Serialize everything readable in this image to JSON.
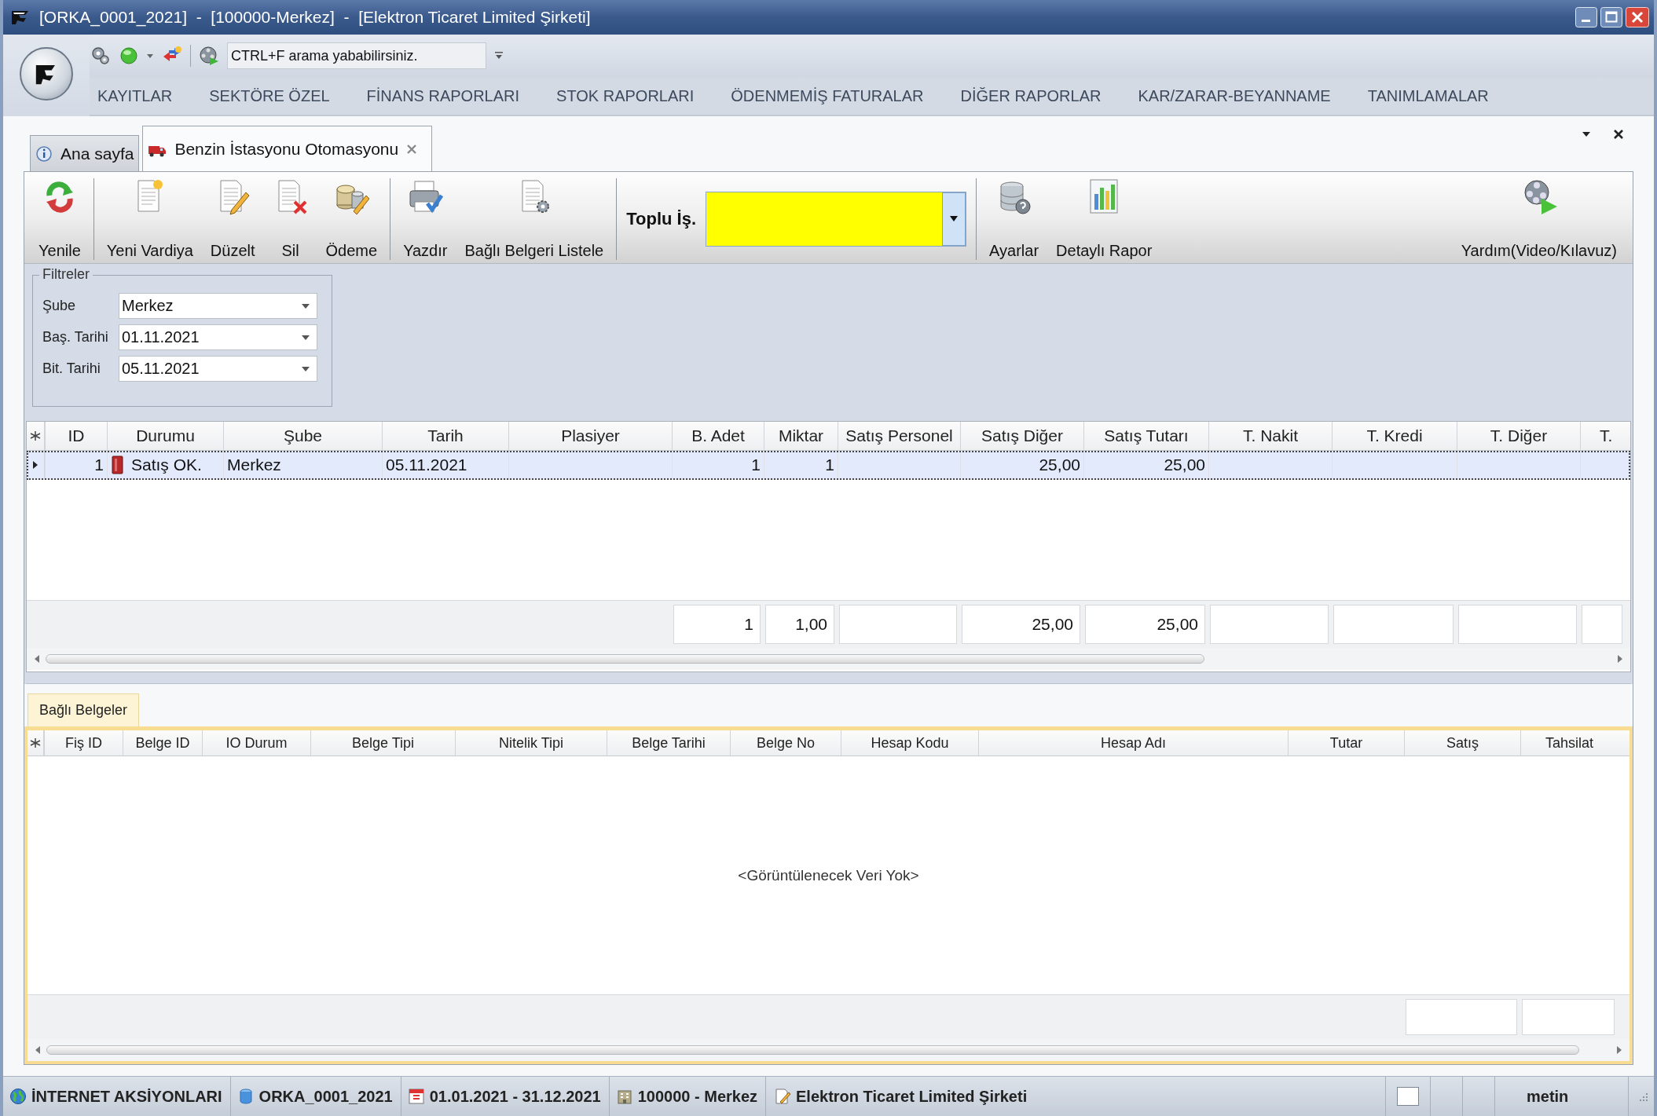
{
  "window": {
    "title": "[ORKA_0001_2021]  -  [100000-Merkez]  -  [Elektron Ticaret Limited Şirketi]"
  },
  "quick_access": {
    "search": {
      "placeholder": "CTRL+F arama yababilirsiniz."
    }
  },
  "menu": [
    "KAYITLAR",
    "SEKTÖRE ÖZEL",
    "FİNANS RAPORLARI",
    "STOK RAPORLARI",
    "ÖDENMEMİŞ FATURALAR",
    "DİĞER RAPORLAR",
    "KAR/ZARAR-BEYANNAME",
    "TANIMLAMALAR"
  ],
  "tabs": [
    {
      "label": "Ana sayfa",
      "selected": false
    },
    {
      "label": "Benzin İstasyonu Otomasyonu",
      "selected": true
    }
  ],
  "toolbar": {
    "groups": [
      [
        "Yenile"
      ],
      [
        "Yeni Vardiya",
        "Düzelt",
        "Sil",
        "Ödeme"
      ],
      [
        "Yazdır",
        "Bağlı Belgeri Listele"
      ]
    ],
    "bulk": {
      "label": "Toplu İş."
    },
    "right_buttons": [
      "Ayarlar",
      "Detaylı Rapor"
    ],
    "help_button": "Yardım(Video/Kılavuz)"
  },
  "filters": {
    "title": "Filtreler",
    "fields": [
      {
        "label": "Şube",
        "value": "Merkez"
      },
      {
        "label": "Baş. Tarihi",
        "value": "01.11.2021"
      },
      {
        "label": "Bit. Tarihi",
        "value": "05.11.2021"
      }
    ]
  },
  "grid": {
    "columns": [
      "ID",
      "Durumu",
      "Şube",
      "Tarih",
      "Plasiyer",
      "B. Adet",
      "Miktar",
      "Satış Personel",
      "Satış Diğer",
      "Satış Tutarı",
      "T. Nakit",
      "T. Kredi",
      "T. Diğer",
      "T."
    ],
    "rows": [
      {
        "selected": true,
        "cells": [
          "1",
          "Satış OK.",
          "Merkez",
          "05.11.2021",
          null,
          "1",
          "1",
          null,
          "25,00",
          "25,00",
          null,
          null,
          null,
          null
        ]
      }
    ],
    "totals": {
      "b_adet": "1",
      "miktar": "1,00",
      "satis_diger": "25,00",
      "satis_tutari": "25,00"
    }
  },
  "detail": {
    "tabs": [
      {
        "label": "Bağlı Belgeler",
        "selected": true
      }
    ],
    "columns": [
      "Fiş ID",
      "Belge ID",
      "IO Durum",
      "Belge Tipi",
      "Nitelik Tipi",
      "Belge Tarihi",
      "Belge No",
      "Hesap Kodu",
      "Hesap Adı",
      "Tutar",
      "Satış",
      "Tahsilat"
    ],
    "empty_text": "<Görüntülenecek Veri Yok>"
  },
  "status_bar": {
    "items": [
      "İNTERNET AKSİYONLARI",
      "ORKA_0001_2021",
      "01.01.2021 - 31.12.2021",
      "100000 - Merkez",
      "Elektron Ticaret Limited Şirketi"
    ],
    "user": "metin"
  }
}
